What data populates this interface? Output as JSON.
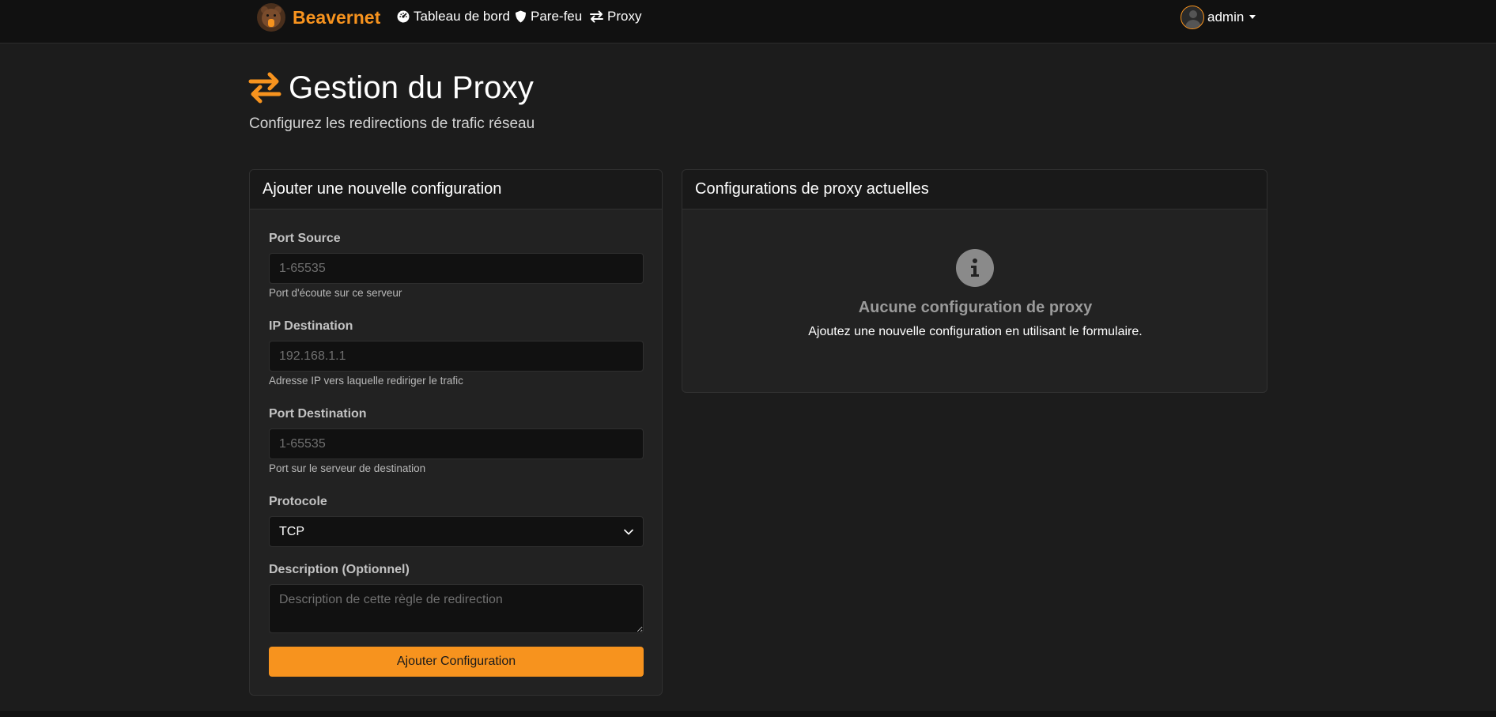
{
  "navbar": {
    "brand": "Beavernet",
    "links": [
      {
        "label": "Tableau de bord",
        "icon": "gauge-icon"
      },
      {
        "label": "Pare-feu",
        "icon": "shield-icon"
      },
      {
        "label": "Proxy",
        "icon": "exchange-icon"
      }
    ],
    "user": "admin"
  },
  "header": {
    "title": "Gestion du Proxy",
    "subtitle": "Configurez les redirections de trafic réseau"
  },
  "form": {
    "title": "Ajouter une nouvelle configuration",
    "source_port": {
      "label": "Port Source",
      "placeholder": "1-65535",
      "help": "Port d'écoute sur ce serveur"
    },
    "dest_ip": {
      "label": "IP Destination",
      "placeholder": "192.168.1.1",
      "help": "Adresse IP vers laquelle rediriger le trafic"
    },
    "dest_port": {
      "label": "Port Destination",
      "placeholder": "1-65535",
      "help": "Port sur le serveur de destination"
    },
    "protocol": {
      "label": "Protocole",
      "value": "TCP"
    },
    "description": {
      "label": "Description (Optionnel)",
      "placeholder": "Description de cette règle de redirection"
    },
    "submit": "Ajouter Configuration"
  },
  "list": {
    "title": "Configurations de proxy actuelles",
    "empty_title": "Aucune configuration de proxy",
    "empty_text": "Ajoutez une nouvelle configuration en utilisant le formulaire."
  },
  "colors": {
    "accent": "#f7931e",
    "background": "#1c1c1c",
    "navbar": "#111111",
    "card": "#222222"
  }
}
